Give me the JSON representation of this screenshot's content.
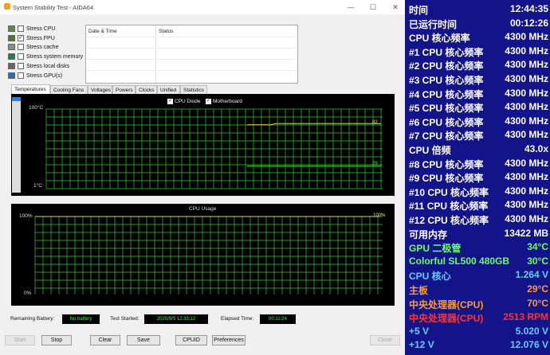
{
  "window": {
    "title": "System Stability Test - AIDA64"
  },
  "stress": [
    {
      "label": "Stress CPU",
      "checked": false,
      "icon": "cpu-icon"
    },
    {
      "label": "Stress FPU",
      "checked": true,
      "icon": "fpu-icon"
    },
    {
      "label": "Stress cache",
      "checked": false,
      "icon": "cache-icon"
    },
    {
      "label": "Stress system memory",
      "checked": false,
      "icon": "memory-icon"
    },
    {
      "label": "Stress local disks",
      "checked": false,
      "icon": "disk-icon"
    },
    {
      "label": "Stress GPU(s)",
      "checked": false,
      "icon": "gpu-icon"
    }
  ],
  "log": {
    "col_date": "Date & Time",
    "col_status": "Status"
  },
  "tabs": [
    "Temperatures",
    "Cooling Fans",
    "Voltages",
    "Powers",
    "Clocks",
    "Unified",
    "Statistics"
  ],
  "temp_chart": {
    "legend": [
      "CPU Diode",
      "Motherboard"
    ],
    "ymax_label": "100°C",
    "ymin_label": "1°C",
    "value_a": "82",
    "value_b": "29"
  },
  "cpu_chart": {
    "title": "CPU Usage",
    "ymax_label": "100%",
    "ymin_label": "0%",
    "value": "100%"
  },
  "chart_data": [
    {
      "type": "line",
      "title": "",
      "series": [
        {
          "name": "CPU Diode",
          "values": [
            82
          ]
        },
        {
          "name": "Motherboard",
          "values": [
            29
          ]
        }
      ],
      "ylim": [
        1,
        100
      ],
      "xlabel": "",
      "ylabel": ""
    },
    {
      "type": "line",
      "title": "CPU Usage",
      "series": [
        {
          "name": "",
          "values": [
            100
          ]
        }
      ],
      "ylim": [
        0,
        100
      ],
      "xlabel": "",
      "ylabel": ""
    }
  ],
  "status": {
    "battery_label": "Remaining Battery:",
    "battery_value": "No battery",
    "started_label": "Test Started:",
    "started_value": "2020/9/5 12:33:12",
    "elapsed_label": "Elapsed Time:",
    "elapsed_value": "00:11:24"
  },
  "buttons": {
    "start": "Start",
    "stop": "Stop",
    "clear": "Clear",
    "save": "Save",
    "cpuid": "CPUID",
    "preferences": "Preferences",
    "close": "Close"
  },
  "osd": [
    {
      "label": "时间",
      "value": "12:44:35",
      "color": "#ffffff"
    },
    {
      "label": "已运行时间",
      "value": "00:12:26",
      "color": "#ffffff"
    },
    {
      "label": "CPU 核心频率",
      "value": "4300 MHz",
      "color": "#ffffff"
    },
    {
      "label": "#1 CPU 核心频率",
      "value": "4300 MHz",
      "color": "#ffffff"
    },
    {
      "label": "#2 CPU 核心频率",
      "value": "4300 MHz",
      "color": "#ffffff"
    },
    {
      "label": "#3 CPU 核心频率",
      "value": "4300 MHz",
      "color": "#ffffff"
    },
    {
      "label": "#4 CPU 核心频率",
      "value": "4300 MHz",
      "color": "#ffffff"
    },
    {
      "label": "#5 CPU 核心频率",
      "value": "4300 MHz",
      "color": "#ffffff"
    },
    {
      "label": "#6 CPU 核心频率",
      "value": "4300 MHz",
      "color": "#ffffff"
    },
    {
      "label": "#7 CPU 核心频率",
      "value": "4300 MHz",
      "color": "#ffffff"
    },
    {
      "label": "CPU 倍频",
      "value": "43.0x",
      "color": "#ffffff"
    },
    {
      "label": "#8 CPU 核心频率",
      "value": "4300 MHz",
      "color": "#ffffff"
    },
    {
      "label": "#9 CPU 核心频率",
      "value": "4300 MHz",
      "color": "#ffffff"
    },
    {
      "label": "#10 CPU 核心频率",
      "value": "4300 MHz",
      "color": "#ffffff"
    },
    {
      "label": "#11 CPU 核心频率",
      "value": "4300 MHz",
      "color": "#ffffff"
    },
    {
      "label": "#12 CPU 核心频率",
      "value": "4300 MHz",
      "color": "#ffffff"
    },
    {
      "label": "可用内存",
      "value": "13422 MB",
      "color": "#ffffff"
    },
    {
      "label": "GPU 二极管",
      "value": "34°C",
      "color": "#66ff66"
    },
    {
      "label": "Colorful SL500 480GB",
      "value": "30°C",
      "color": "#66ff66"
    },
    {
      "label": "CPU 核心",
      "value": "1.264 V",
      "color": "#66ccff"
    },
    {
      "label": "主板",
      "value": "29°C",
      "color": "#ff9933"
    },
    {
      "label": "中央处理器(CPU)",
      "value": "70°C",
      "color": "#ff9933"
    },
    {
      "label": "中央处理器(CPU)",
      "value": "2513 RPM",
      "color": "#ff3333"
    },
    {
      "label": "+5 V",
      "value": "5.020 V",
      "color": "#66ccff"
    },
    {
      "label": "+12 V",
      "value": "12.076 V",
      "color": "#66ccff"
    }
  ],
  "colors": {
    "graph_line": "#33cc33",
    "trace": "#dddd44",
    "osd_bg": "#14148a"
  }
}
